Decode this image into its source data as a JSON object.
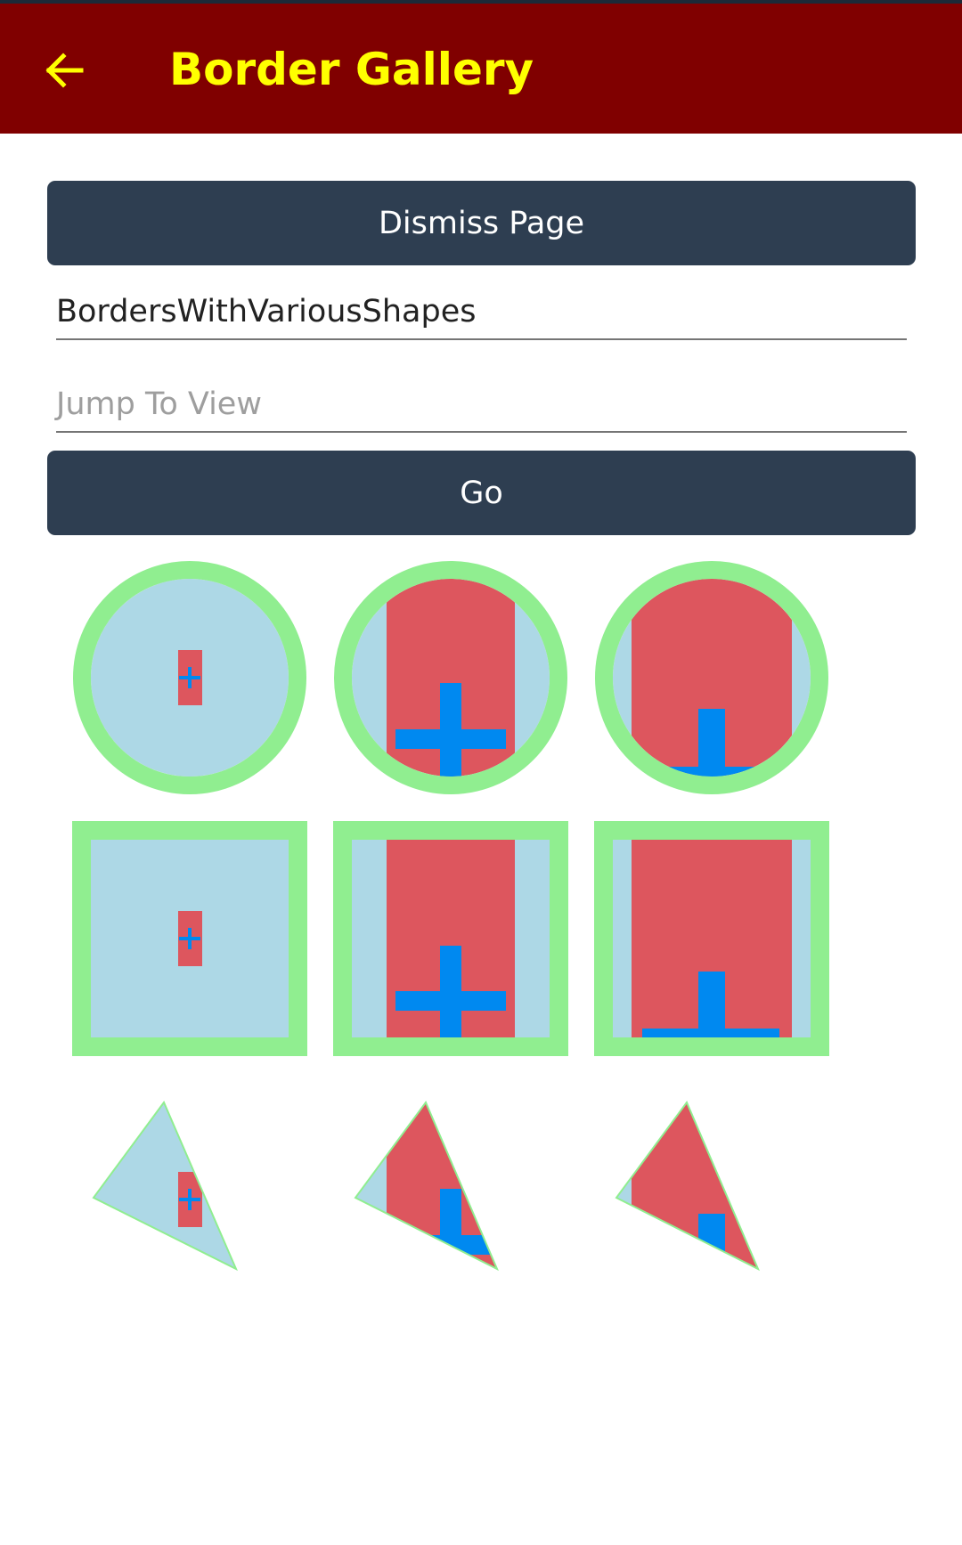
{
  "header": {
    "title": "Border Gallery",
    "back_icon": "arrow-left-icon"
  },
  "actions": {
    "dismiss_label": "Dismiss Page",
    "go_label": "Go"
  },
  "fields": {
    "page_name_value": "BordersWithVariousShapes",
    "jump_placeholder": "Jump To View"
  },
  "gallery": {
    "shapes": [
      "circle",
      "square",
      "triangle"
    ],
    "content_variants": [
      "small-centered",
      "wide-plus",
      "bottom-aligned-plus"
    ]
  },
  "colors": {
    "app_bar": "#800000",
    "title": "#ffff00",
    "button": "#2e3e51",
    "border_stroke": "#90ee90",
    "shape_fill": "#add8e6",
    "content_fill": "#dd565e",
    "plus_fill": "#0089f0"
  }
}
